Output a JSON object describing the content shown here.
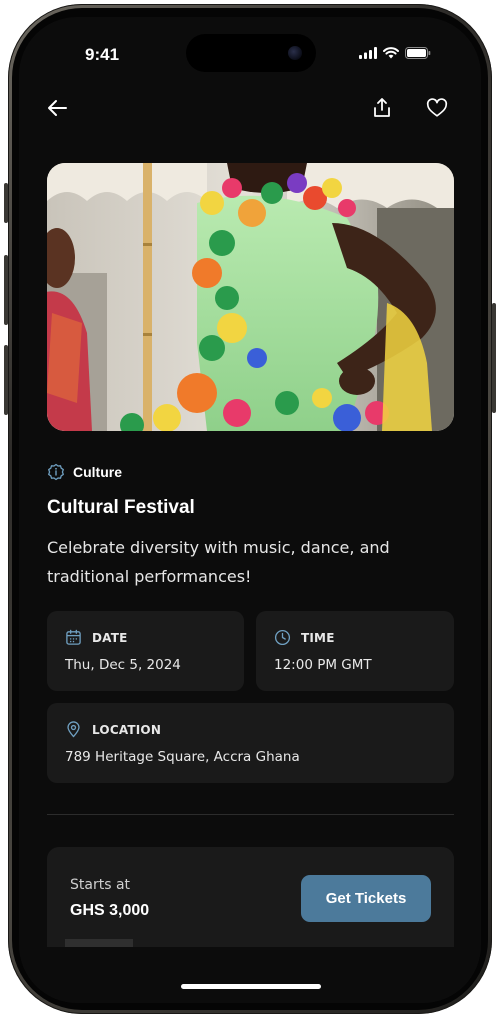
{
  "status_bar": {
    "time": "9:41"
  },
  "nav": {
    "back_icon": "arrow-left-icon",
    "share_icon": "share-upload-icon",
    "favorite_icon": "heart-outline-icon"
  },
  "event": {
    "category": "Culture",
    "category_icon": "info-badge-icon",
    "title": "Cultural Festival",
    "description": "Celebrate diversity with music, dance, and traditional performances!",
    "details": {
      "date": {
        "label": "DATE",
        "value": "Thu, Dec 5, 2024",
        "icon": "calendar-icon"
      },
      "time": {
        "label": "TIME",
        "value": "12:00 PM GMT",
        "icon": "clock-icon"
      },
      "location": {
        "label": "LOCATION",
        "value": "789 Heritage Square, Accra Ghana",
        "icon": "map-pin-icon"
      }
    }
  },
  "tickets": {
    "starts_label": "Starts at",
    "price": "GHS 3,000",
    "button_label": "Get Tickets"
  },
  "colors": {
    "background": "#0c0c0c",
    "card": "#1a1a1a",
    "accent": "#4c7a9b",
    "icon_accent": "#6f9fc0"
  }
}
